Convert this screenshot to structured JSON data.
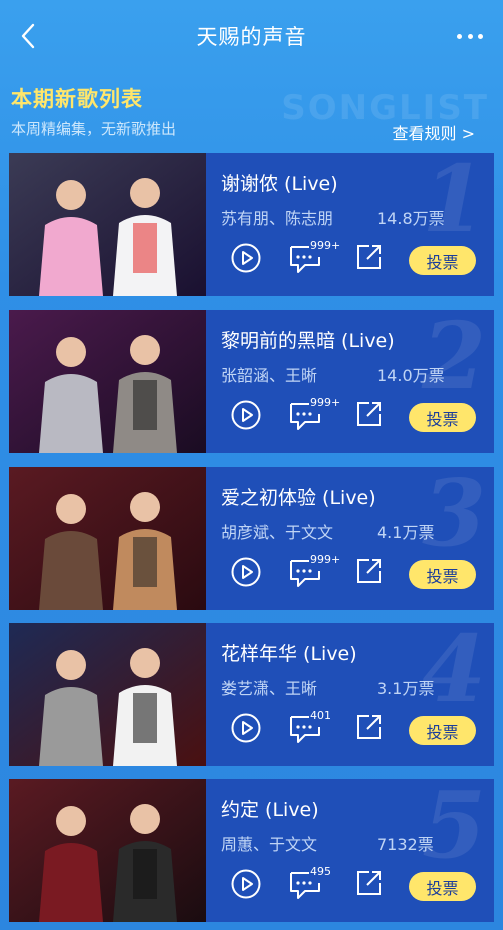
{
  "navbar": {
    "title": "天赐的声音"
  },
  "section": {
    "title": "本期新歌列表",
    "subtitle": "本周精编集，无新歌推出",
    "watermark": "SONGLIST",
    "rules_link": "查看规则 >"
  },
  "vote_label": "投票",
  "songs": [
    {
      "rank": "1",
      "title": "谢谢侬 (Live)",
      "singers": "苏有朋、陈志朋",
      "votes": "14.8万票",
      "comments": "999+",
      "art": {
        "bg": "#3b3b55",
        "bg2": "#1a1030",
        "p1": "#f1a9cf",
        "p2": "#f3f3f5",
        "accent": "#e32a2a"
      }
    },
    {
      "rank": "2",
      "title": "黎明前的黑暗 (Live)",
      "singers": "张韶涵、王晰",
      "votes": "14.0万票",
      "comments": "999+",
      "art": {
        "bg": "#4a1a4c",
        "bg2": "#1a0c22",
        "p1": "#b9b9c2",
        "p2": "#8f8a86",
        "accent": "#1c1c1c"
      }
    },
    {
      "rank": "3",
      "title": "爱之初体验 (Live)",
      "singers": "胡彦斌、于文文",
      "votes": "4.1万票",
      "comments": "999+",
      "art": {
        "bg": "#5a1a22",
        "bg2": "#2a0a10",
        "p1": "#6a4a3a",
        "p2": "#c08a5e",
        "accent": "#222222"
      }
    },
    {
      "rank": "4",
      "title": "花样年华 (Live)",
      "singers": "娄艺潇、王晰",
      "votes": "3.1万票",
      "comments": "401",
      "art": {
        "bg": "#1e2a55",
        "bg2": "#4a1010",
        "p1": "#9a9a9a",
        "p2": "#f2f2f2",
        "accent": "#111111"
      }
    },
    {
      "rank": "5",
      "title": "约定 (Live)",
      "singers": "周蕙、于文文",
      "votes": "7132票",
      "comments": "495",
      "art": {
        "bg": "#5a1a22",
        "bg2": "#1a0c10",
        "p1": "#7a1a22",
        "p2": "#2a2a2a",
        "accent": "#111111"
      }
    }
  ]
}
